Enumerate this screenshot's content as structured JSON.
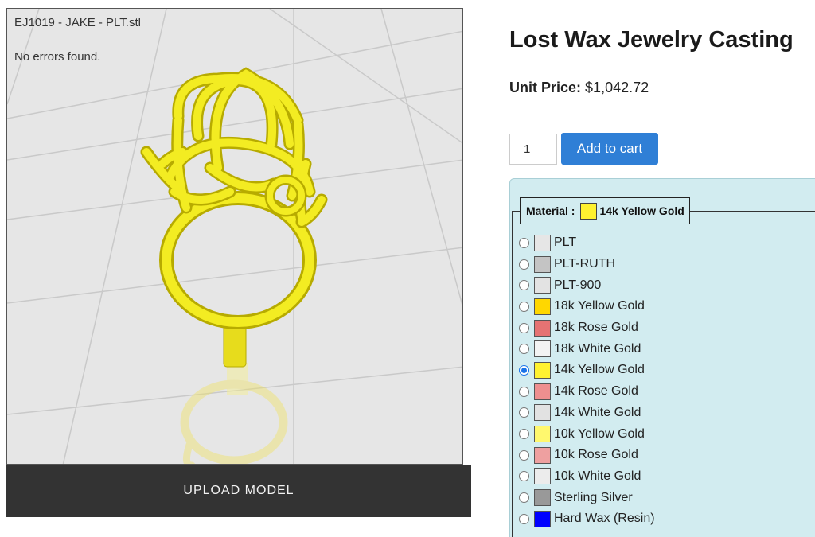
{
  "viewer": {
    "file_name": "EJ1019 - JAKE - PLT.stl",
    "status": "No errors found.",
    "model_color": "#f4ee1f"
  },
  "upload": {
    "label": "UPLOAD MODEL"
  },
  "product": {
    "title": "Lost Wax Jewelry Casting",
    "price_label": "Unit Price:",
    "price_value": "$1,042.72"
  },
  "cart": {
    "quantity": "1",
    "add_label": "Add to cart"
  },
  "material": {
    "legend_label": "Material :",
    "selected_name": "14k Yellow Gold",
    "selected_color": "#fff230",
    "options": [
      {
        "name": "PLT",
        "color": "#e6e6e6",
        "checked": false
      },
      {
        "name": "PLT-RUTH",
        "color": "#c4c4c4",
        "checked": false
      },
      {
        "name": "PLT-900",
        "color": "#e3e3e3",
        "checked": false
      },
      {
        "name": "18k Yellow Gold",
        "color": "#ffd700",
        "checked": false
      },
      {
        "name": "18k Rose Gold",
        "color": "#e57373",
        "checked": false
      },
      {
        "name": "18k White Gold",
        "color": "#f3f3f3",
        "checked": false
      },
      {
        "name": "14k Yellow Gold",
        "color": "#fff230",
        "checked": true
      },
      {
        "name": "14k Rose Gold",
        "color": "#ee8f8f",
        "checked": false
      },
      {
        "name": "14k White Gold",
        "color": "#e2e2e2",
        "checked": false
      },
      {
        "name": "10k Yellow Gold",
        "color": "#fff86e",
        "checked": false
      },
      {
        "name": "10k Rose Gold",
        "color": "#eea0a0",
        "checked": false
      },
      {
        "name": "10k White Gold",
        "color": "#ececec",
        "checked": false
      },
      {
        "name": "Sterling Silver",
        "color": "#999999",
        "checked": false
      },
      {
        "name": "Hard Wax (Resin)",
        "color": "#0000ff",
        "checked": false
      }
    ]
  }
}
